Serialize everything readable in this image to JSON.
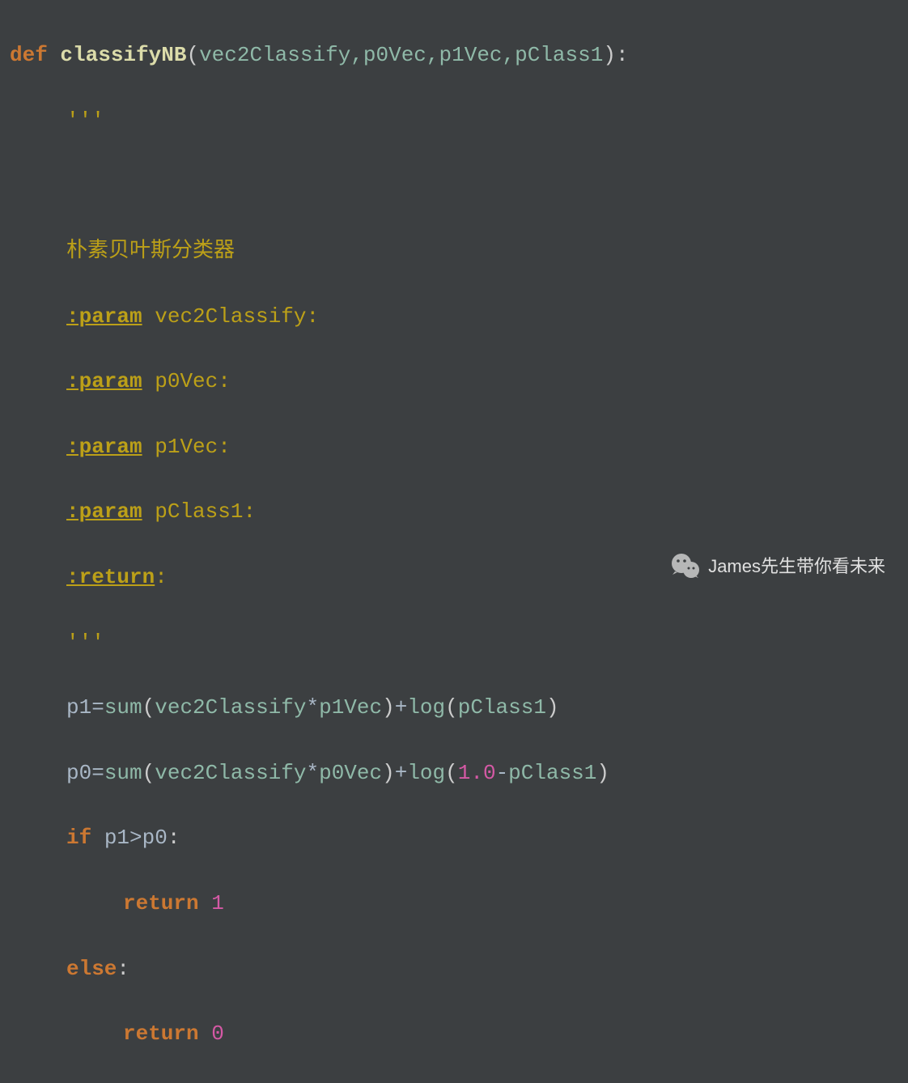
{
  "code": {
    "kw_def": "def",
    "fn_name": "classifyNB",
    "params": "vec2Classify,p0Vec,p1Vec,pClass1",
    "docstring_open": "'''",
    "doc_title": "朴素贝叶斯分类器",
    "doc_param_label": ":param",
    "doc_param1": "vec2Classify:",
    "doc_param2": "p0Vec:",
    "doc_param3": "p1Vec:",
    "doc_param4": "pClass1:",
    "doc_return_label": ":return",
    "docstring_close": "'''",
    "p1_var": "p1",
    "eq": "=",
    "sum_fn": "sum",
    "vec2classify": "vec2Classify",
    "mul": "*",
    "p1vec": "p1Vec",
    "p0vec": "p0Vec",
    "plus": "+",
    "log_fn": "log",
    "pclass1": "pClass1",
    "p0_var": "p0",
    "float_one": "1.0",
    "minus": "-",
    "kw_if": "if",
    "gt": ">",
    "colon": ":",
    "kw_return": "return",
    "ret_1": "1",
    "kw_else": "else",
    "ret_0": "0"
  },
  "watermark": {
    "text": "James先生带你看未来"
  }
}
